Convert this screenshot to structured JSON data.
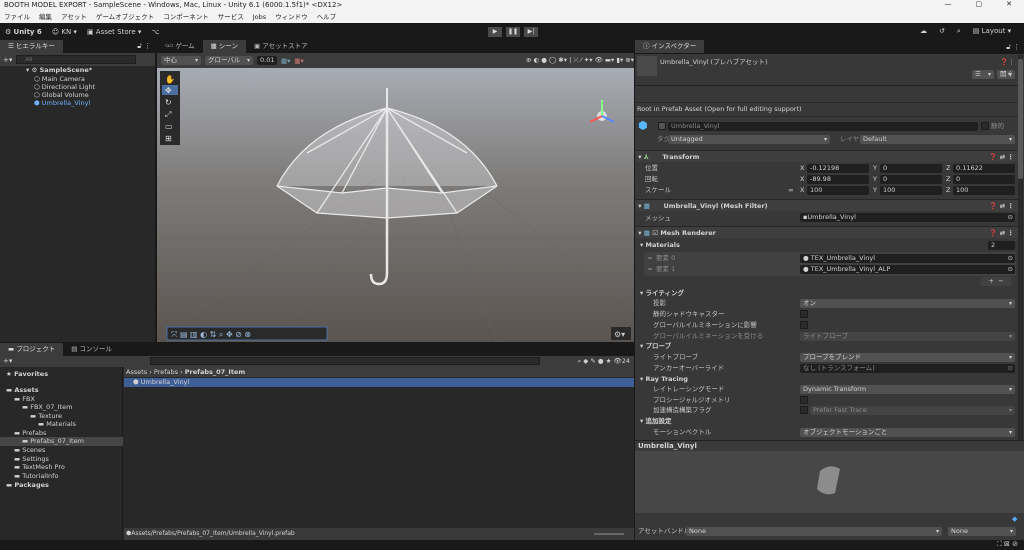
{
  "window": {
    "title": "BOOTH MODEL EXPORT - SampleScene - Windows, Mac, Linux - Unity 6.1 (6000.1.5f1)* <DX12>",
    "controls": [
      "—",
      "▢",
      "✕"
    ]
  },
  "menu": [
    "ファイル",
    "編集",
    "アセット",
    "ゲームオブジェクト",
    "コンポーネント",
    "サービス",
    "Jobs",
    "ウィンドウ",
    "ヘルプ"
  ],
  "toolbar": {
    "unity": "Unity 6",
    "account": "KN",
    "asset_store": "Asset Store",
    "layout": "Layout"
  },
  "hierarchy": {
    "tab": "ヒエラルキー",
    "search_placeholder": "All",
    "scene": "SampleScene*",
    "items": [
      "Main Camera",
      "Directional Light",
      "Global Volume",
      "Umbrella_Vinyl"
    ]
  },
  "scene_tabs": [
    "ゲーム",
    "シーン",
    "アセットストア"
  ],
  "scene_toolbar": {
    "pivot": "中心",
    "space": "グローバル",
    "snap": "0.01"
  },
  "project": {
    "tabs": [
      "プロジェクト",
      "コンソール"
    ],
    "tree": [
      {
        "label": "Favorites",
        "indent": 0
      },
      {
        "label": "Assets",
        "indent": 0
      },
      {
        "label": "FBX",
        "indent": 1
      },
      {
        "label": "FBX_07_Item",
        "indent": 2
      },
      {
        "label": "Texture",
        "indent": 3
      },
      {
        "label": "Materials",
        "indent": 4
      },
      {
        "label": "Prefabs",
        "indent": 1
      },
      {
        "label": "Prefabs_07_Item",
        "indent": 2
      },
      {
        "label": "Scenes",
        "indent": 1
      },
      {
        "label": "Settings",
        "indent": 1
      },
      {
        "label": "TextMesh Pro",
        "indent": 1
      },
      {
        "label": "TutorialInfo",
        "indent": 1
      },
      {
        "label": "Packages",
        "indent": 0
      }
    ],
    "breadcrumb": [
      "Assets",
      "Prefabs",
      "Prefabs_07_Item"
    ],
    "selected_asset": "Umbrella_Vinyl",
    "count": "24",
    "path": "Assets/Prefabs/Prefabs_07_Item/Umbrella_Vinyl.prefab"
  },
  "inspector": {
    "tab": "インスペクター",
    "title": "Umbrella_Vinyl (プレハブアセット)",
    "open_btn": "開く",
    "root_note": "Root in Prefab Asset (Open for full editing support)",
    "name": "Umbrella_Vinyl",
    "static": "静的",
    "tag_label": "タグ",
    "tag": "Untagged",
    "layer_label": "レイヤー",
    "layer": "Default",
    "transform": {
      "title": "Transform",
      "rows": [
        {
          "label": "位置",
          "x": "-0.12198",
          "y": "0",
          "z": "0.11622"
        },
        {
          "label": "回転",
          "x": "-89.98",
          "y": "0",
          "z": "0"
        },
        {
          "label": "スケール",
          "x": "100",
          "y": "100",
          "z": "100"
        }
      ]
    },
    "mesh_filter": {
      "title": "Umbrella_Vinyl (Mesh Filter)",
      "mesh_label": "メッシュ",
      "mesh": "Umbrella_Vinyl"
    },
    "mesh_renderer": {
      "title": "Mesh Renderer",
      "materials_label": "Materials",
      "materials_count": "2",
      "materials": [
        {
          "label": "要素 0",
          "value": "TEX_Umbrella_Vinyl"
        },
        {
          "label": "要素 1",
          "value": "TEX_Umbrella_Vinyl_ALP"
        }
      ],
      "lighting": "ライティング",
      "cast_label": "投影",
      "cast": "オン",
      "static_shadow": "静的シャドウキャスター",
      "gi": "グローバルイルミネーションに影響",
      "gi_recv": "グローバルイルミネーションを受ける",
      "gi_recv_val": "ライトプローブ",
      "probes": "プローブ",
      "lp_label": "ライトプローブ",
      "lp": "プローブをブレンド",
      "anchor_label": "アンカーオーバーライド",
      "anchor": "なし (トランスフォーム)",
      "rt": "Ray Tracing",
      "rt_mode_label": "レイトレーシングモード",
      "rt_mode": "Dynamic Transform",
      "procedural": "プロシージャルジオメトリ",
      "accel_label": "加速構造構築フラグ",
      "accel": "Prefer Fast Trace",
      "extra": "追加設定",
      "motion_label": "モーションベクトル",
      "motion": "オブジェクトモーションごと"
    },
    "preview_title": "Umbrella_Vinyl",
    "bundle_label": "アセットバンドル",
    "bundle": "None",
    "variant": "None"
  }
}
